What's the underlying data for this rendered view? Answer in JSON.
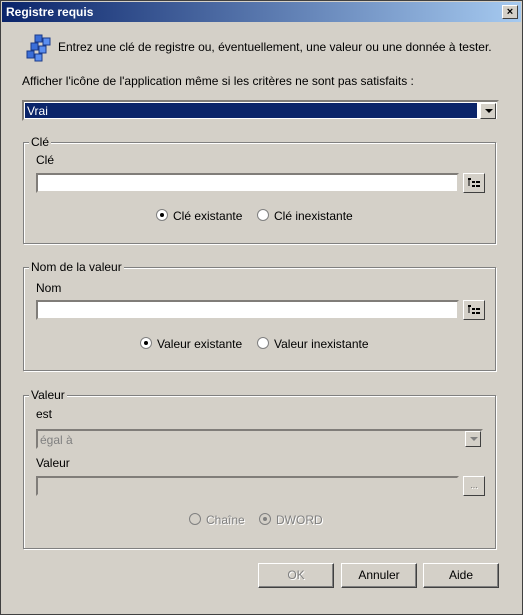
{
  "window": {
    "title": "Registre requis"
  },
  "intro_text": "Entrez une clé de registre ou, éventuellement, une valeur ou une donnée à tester.",
  "show_icon_label": "Afficher l'icône de l'application même si les critères ne sont pas satisfaits :",
  "show_icon_select": {
    "value": "Vrai"
  },
  "key_group": {
    "legend": "Clé",
    "field_label": "Clé",
    "input_value": "",
    "radio_existing": "Clé existante",
    "radio_nonexisting": "Clé inexistante",
    "selected": "existing"
  },
  "value_name_group": {
    "legend": "Nom de la valeur",
    "field_label": "Nom",
    "input_value": "",
    "radio_existing": "Valeur existante",
    "radio_nonexisting": "Valeur inexistante",
    "selected": "existing"
  },
  "value_group": {
    "legend": "Valeur",
    "operator_label": "est",
    "operator_value": "égal à",
    "value_label": "Valeur",
    "value_input": "",
    "browse_label": "...",
    "radio_string": "Chaîne",
    "radio_dword": "DWORD",
    "selected": "dword"
  },
  "buttons": {
    "ok": "OK",
    "cancel": "Annuler",
    "help": "Aide"
  },
  "colors": {
    "title_start": "#0a246a",
    "title_end": "#a6caf0",
    "selection": "#0a246a",
    "face": "#d4d0c8"
  }
}
